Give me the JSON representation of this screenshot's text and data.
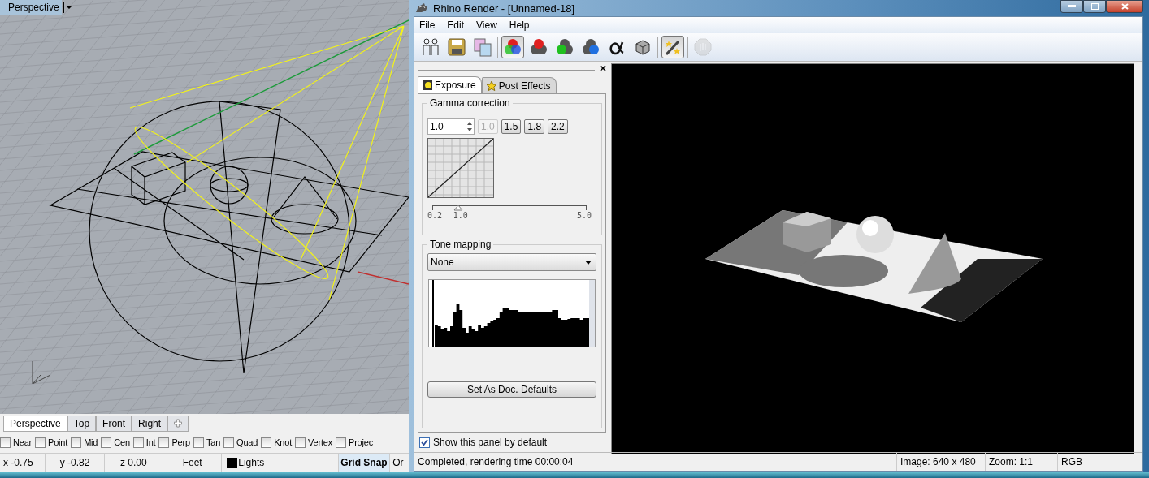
{
  "viewport": {
    "title": "Perspective",
    "tabs": [
      {
        "label": "Perspective",
        "selected": true
      },
      {
        "label": "Top",
        "selected": false
      },
      {
        "label": "Front",
        "selected": false
      },
      {
        "label": "Right",
        "selected": false
      }
    ],
    "osnaps": [
      {
        "label": "Near",
        "checked": false
      },
      {
        "label": "Point",
        "checked": false
      },
      {
        "label": "Mid",
        "checked": false
      },
      {
        "label": "Cen",
        "checked": false
      },
      {
        "label": "Int",
        "checked": false
      },
      {
        "label": "Perp",
        "checked": false
      },
      {
        "label": "Tan",
        "checked": false
      },
      {
        "label": "Quad",
        "checked": false
      },
      {
        "label": "Knot",
        "checked": false
      },
      {
        "label": "Vertex",
        "checked": false
      },
      {
        "label": "Projec",
        "checked": false
      }
    ],
    "status": {
      "x": "x -0.75",
      "y": "y -0.82",
      "z": "z 0.00",
      "units": "Feet",
      "layer": {
        "name": "Lights",
        "color": "#000000"
      },
      "grid_snap": {
        "label": "Grid Snap",
        "on": true
      },
      "ortho": "Or"
    }
  },
  "render_window": {
    "title": "Rhino Render - [Unnamed-18]",
    "menu": [
      "File",
      "Edit",
      "View",
      "Help"
    ],
    "toolbar": [
      [
        {
          "kind": "people",
          "selected": false,
          "disabled": false
        },
        {
          "kind": "save",
          "selected": false,
          "disabled": false
        },
        {
          "kind": "copy",
          "selected": false,
          "disabled": false
        }
      ],
      [
        {
          "kind": "rgb",
          "selected": true,
          "disabled": false
        },
        {
          "kind": "red",
          "selected": false,
          "disabled": false
        },
        {
          "kind": "green",
          "selected": false,
          "disabled": false
        },
        {
          "kind": "blue",
          "selected": false,
          "disabled": false
        },
        {
          "kind": "alpha",
          "selected": false,
          "disabled": false
        },
        {
          "kind": "cube",
          "selected": false,
          "disabled": false
        }
      ],
      [
        {
          "kind": "wand",
          "selected": true,
          "disabled": false
        }
      ],
      [
        {
          "kind": "stop",
          "selected": false,
          "disabled": true
        }
      ]
    ],
    "panel": {
      "tabs": [
        {
          "label": "Exposure",
          "selected": true
        },
        {
          "label": "Post Effects",
          "selected": false
        }
      ],
      "gamma": {
        "title": "Gamma correction",
        "value": "1.0",
        "presets": [
          {
            "label": "1.0",
            "disabled": true
          },
          {
            "label": "1.5",
            "disabled": false
          },
          {
            "label": "1.8",
            "disabled": false
          },
          {
            "label": "2.2",
            "disabled": false
          }
        ],
        "slider": {
          "level": 0.167,
          "min": "0.2",
          "mark": "1.0",
          "max": "5.0"
        }
      },
      "tone": {
        "title": "Tone mapping",
        "selected": "None",
        "button": "Set As Doc. Defaults"
      },
      "show_by_default": {
        "label": "Show this panel by default",
        "checked": true
      }
    },
    "status": {
      "message": "Completed, rendering time 00:00:04",
      "image": "Image: 640 x 480",
      "zoom": "Zoom: 1:1",
      "mode": "RGB"
    }
  }
}
